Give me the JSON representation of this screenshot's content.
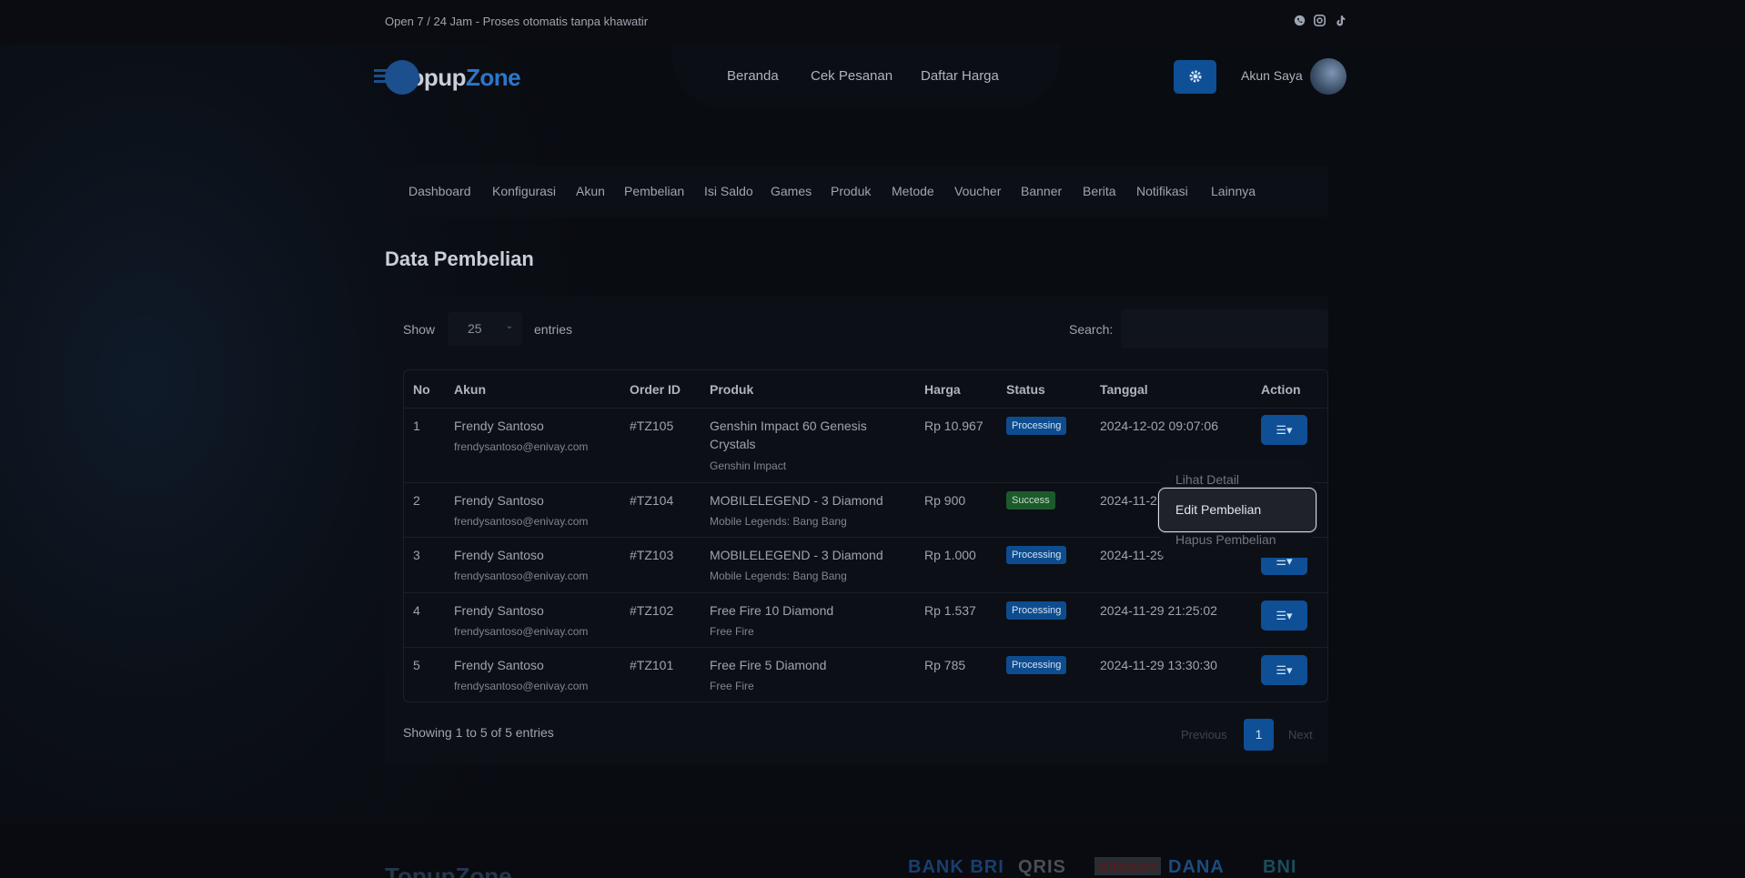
{
  "topbar": {
    "message": "Open 7 / 24 Jam - Proses otomatis tanpa khawatir",
    "social_icons": [
      "whatsapp-icon",
      "instagram-icon",
      "tiktok-icon"
    ]
  },
  "brand": {
    "name_part1": "Topup",
    "name_part2": "Zone",
    "accent": "#2c77c8"
  },
  "nav": {
    "items": [
      "Beranda",
      "Cek Pesanan",
      "Daftar Harga"
    ]
  },
  "user": {
    "account_label": "Akun Saya",
    "settings_icon": "gear-icon"
  },
  "admin_menu": {
    "items": [
      "Dashboard",
      "Konfigurasi",
      "Akun",
      "Pembelian",
      "Isi Saldo",
      "Games",
      "Produk",
      "Metode",
      "Voucher",
      "Banner",
      "Berita",
      "Notifikasi",
      "Lainnya"
    ]
  },
  "page": {
    "title": "Data Pembelian"
  },
  "table_controls": {
    "show_label": "Show",
    "entries_value": "25",
    "entries_label": "entries",
    "search_label": "Search:",
    "search_value": ""
  },
  "table": {
    "columns": [
      "No",
      "Akun",
      "Order ID",
      "Produk",
      "Harga",
      "Status",
      "Tanggal",
      "Action"
    ],
    "rows": [
      {
        "no": "1",
        "name": "Frendy Santoso",
        "email": "frendysantoso@enivay.com",
        "order_id": "#TZ105",
        "product_l1": "Genshin Impact 60 Genesis",
        "product_l2": "Crystals",
        "game": "Genshin Impact",
        "price": "Rp 10.967",
        "status": "Processing",
        "date": "2024-12-02 09:07:06"
      },
      {
        "no": "2",
        "name": "Frendy Santoso",
        "email": "frendysantoso@enivay.com",
        "order_id": "#TZ104",
        "product_l1": "MOBILELEGEND - 3 Diamond",
        "product_l2": "",
        "game": "Mobile Legends: Bang Bang",
        "price": "Rp 900",
        "status": "Success",
        "date": "2024-11-29"
      },
      {
        "no": "3",
        "name": "Frendy Santoso",
        "email": "frendysantoso@enivay.com",
        "order_id": "#TZ103",
        "product_l1": "MOBILELEGEND - 3 Diamond",
        "product_l2": "",
        "game": "Mobile Legends: Bang Bang",
        "price": "Rp 1.000",
        "status": "Processing",
        "date": "2024-11-29"
      },
      {
        "no": "4",
        "name": "Frendy Santoso",
        "email": "frendysantoso@enivay.com",
        "order_id": "#TZ102",
        "product_l1": "Free Fire 10 Diamond",
        "product_l2": "",
        "game": "Free Fire",
        "price": "Rp 1.537",
        "status": "Processing",
        "date": "2024-11-29 21:25:02"
      },
      {
        "no": "5",
        "name": "Frendy Santoso",
        "email": "frendysantoso@enivay.com",
        "order_id": "#TZ101",
        "product_l1": "Free Fire 5 Diamond",
        "product_l2": "",
        "game": "Free Fire",
        "price": "Rp 785",
        "status": "Processing",
        "date": "2024-11-29 13:30:30"
      }
    ]
  },
  "action_menu": {
    "items": [
      "Lihat Detail",
      "Edit Pembelian",
      "Hapus Pembelian"
    ],
    "highlighted": "Edit Pembelian"
  },
  "pagination": {
    "info": "Showing 1 to 5 of 5 entries",
    "previous": "Previous",
    "current": "1",
    "next": "Next"
  },
  "footer": {
    "brand": "TopupZone",
    "partners": [
      "BANK BRI",
      "QRIS",
      "Alfamart",
      "DANA",
      "BNI"
    ]
  },
  "colors": {
    "primary": "#0e4f96",
    "processing": "#0d4c8f",
    "success": "#1c5a2c",
    "background": "#0a0d13"
  }
}
